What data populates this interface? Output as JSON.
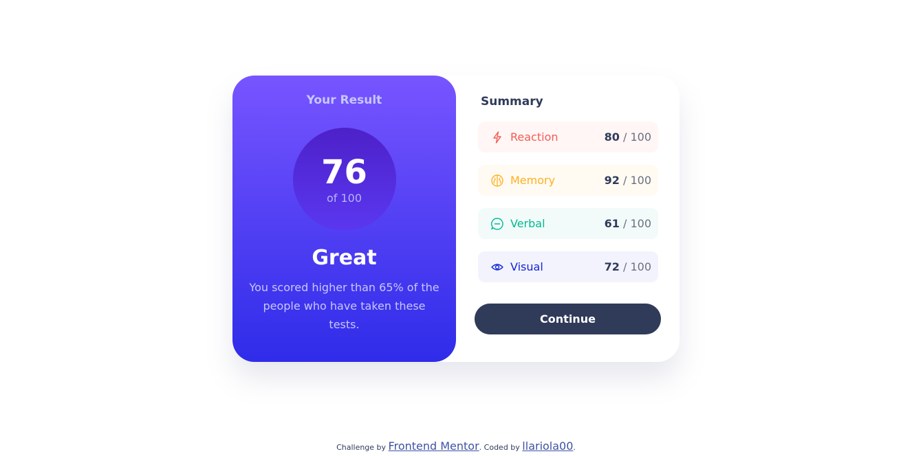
{
  "result": {
    "title": "Your Result",
    "score": "76",
    "score_of": "of 100",
    "rating": "Great",
    "description": "You scored higher than 65% of the people who have taken these tests."
  },
  "summary": {
    "title": "Summary",
    "items": [
      {
        "label": "Reaction",
        "score": "80",
        "max": "/ 100",
        "icon": "lightning-icon",
        "color": "#f25c54",
        "bg": "#fff6f5"
      },
      {
        "label": "Memory",
        "score": "92",
        "max": "/ 100",
        "icon": "brain-icon",
        "color": "#ffb01f",
        "bg": "#fffbf3"
      },
      {
        "label": "Verbal",
        "score": "61",
        "max": "/ 100",
        "icon": "chat-icon",
        "color": "#00bb8f",
        "bg": "#f2fbfa"
      },
      {
        "label": "Visual",
        "score": "72",
        "max": "/ 100",
        "icon": "eye-icon",
        "color": "#1125d4",
        "bg": "#f3f3fd"
      }
    ],
    "continue_label": "Continue"
  },
  "footer": {
    "challenge_prefix": "Challenge by",
    "challenge_link": "Frontend Mentor",
    "coded_prefix": ". Coded by",
    "coded_link": "llariola00",
    "suffix": "."
  }
}
